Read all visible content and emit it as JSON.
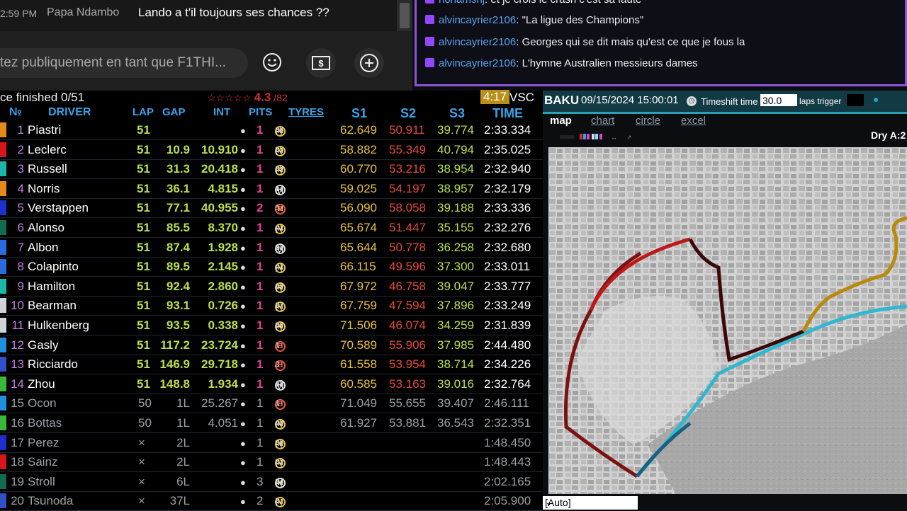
{
  "youtube_chat": {
    "message": {
      "time": "2:59 PM",
      "author": "Papa Ndambo",
      "text": "Lando a t'il toujours ses chances ??"
    },
    "input_placeholder": "tez publiquement en tant que F1THI..."
  },
  "twitch_chat": {
    "messages": [
      {
        "user": "nonamshj",
        "text": "et je crois le crash c'est sa faute"
      },
      {
        "user": "alvincayrier2106",
        "text": "\"La ligue des Champions\""
      },
      {
        "user": "alvincayrier2106",
        "text": "Georges qui se dit mais qu'est ce que je fous la"
      },
      {
        "user": "alvincayrier2106",
        "text": "L'hymne Australien messieurs dames"
      }
    ]
  },
  "timing": {
    "status": "ce finished  0/51",
    "rating_stars": "☆☆☆☆☆",
    "rating_value": "4.3",
    "rating_count": "/82",
    "session_time": "4:17",
    "session_flag": "VSC",
    "headers": {
      "pos": "№",
      "driver": "DRIVER",
      "lap": "LAP",
      "gap": "GAP",
      "int": "INT",
      "pits": "PITS",
      "tyres": "TYRES",
      "s1": "S1",
      "s2": "S2",
      "s3": "S3",
      "time": "TIME"
    },
    "rows": [
      {
        "pos": "1",
        "name": "Piastri",
        "team_color": "#e88a1a",
        "lap": "51",
        "gap": "",
        "int": "",
        "dot": "●",
        "pits": "1",
        "tyres": [
          {
            "c": "M"
          },
          {
            "c": "H",
            "letter": true,
            "age": "36"
          }
        ],
        "s1": "62.649",
        "s2": "50.911",
        "s3": "39.774",
        "time": "2:33.334",
        "dim": false
      },
      {
        "pos": "2",
        "name": "Leclerc",
        "team_color": "#d8151a",
        "lap": "51",
        "gap": "10.9",
        "int": "10.910",
        "dot": "●",
        "pits": "1",
        "tyres": [
          {
            "c": "M"
          },
          {
            "c": "H",
            "letter": true,
            "age": "35"
          }
        ],
        "s1": "58.882",
        "s2": "55.349",
        "s3": "40.794",
        "time": "2:35.025",
        "dim": false
      },
      {
        "pos": "3",
        "name": "Russell",
        "team_color": "#1ab8a8",
        "lap": "51",
        "gap": "31.3",
        "int": "20.418",
        "dot": "●",
        "pits": "1",
        "tyres": [
          {
            "c": "M"
          },
          {
            "c": "H",
            "letter": true,
            "age": "39"
          }
        ],
        "s1": "60.770",
        "s2": "53.216",
        "s3": "38.954",
        "time": "2:32.940",
        "dim": false
      },
      {
        "pos": "4",
        "name": "Norris",
        "team_color": "#e88a1a",
        "lap": "51",
        "gap": "36.1",
        "int": "4.815",
        "dot": "●",
        "pits": "1",
        "tyres": [
          {
            "c": "H"
          },
          {
            "c": "M",
            "letter": true,
            "age": "14"
          }
        ],
        "s1": "59.025",
        "s2": "54.197",
        "s3": "38.957",
        "time": "2:32.179",
        "dim": false
      },
      {
        "pos": "5",
        "name": "Verstappen",
        "team_color": "#1e2fcf",
        "lap": "51",
        "gap": "77.1",
        "int": "40.955",
        "dot": "●",
        "pits": "2",
        "tyres": [
          {
            "c": "M"
          },
          {
            "c": "H"
          },
          {
            "c": "S",
            "age": "5"
          }
        ],
        "s1": "56.090",
        "s2": "58.058",
        "s3": "39.188",
        "time": "2:33.336",
        "dim": false
      },
      {
        "pos": "6",
        "name": "Alonso",
        "team_color": "#0f6b52",
        "lap": "51",
        "gap": "85.5",
        "int": "8.370",
        "dot": "●",
        "pits": "1",
        "tyres": [
          {
            "c": "M"
          },
          {
            "c": "H",
            "letter": true,
            "age": "41"
          }
        ],
        "s1": "65.674",
        "s2": "51.447",
        "s3": "35.155",
        "time": "2:32.276",
        "dim": false
      },
      {
        "pos": "7",
        "name": "Albon",
        "team_color": "#2a6be0",
        "lap": "51",
        "gap": "87.4",
        "int": "1.928",
        "dot": "●",
        "pits": "1",
        "tyres": [
          {
            "c": "H"
          },
          {
            "c": "M",
            "letter": true,
            "age": "20"
          }
        ],
        "s1": "65.644",
        "s2": "50.778",
        "s3": "36.258",
        "time": "2:32.680",
        "dim": false
      },
      {
        "pos": "8",
        "name": "Colapinto",
        "team_color": "#2a6be0",
        "lap": "51",
        "gap": "89.5",
        "int": "2.145",
        "dot": "●",
        "pits": "1",
        "tyres": [
          {
            "c": "M"
          },
          {
            "c": "H",
            "letter": true,
            "age": "41"
          }
        ],
        "s1": "66.115",
        "s2": "49.596",
        "s3": "37.300",
        "time": "2:33.011",
        "dim": false
      },
      {
        "pos": "9",
        "name": "Hamilton",
        "team_color": "#1ab8a8",
        "lap": "51",
        "gap": "92.4",
        "int": "2.860",
        "dot": "●",
        "pits": "1",
        "tyres": [
          {
            "c": "M"
          },
          {
            "c": "H",
            "letter": true,
            "age": "39"
          }
        ],
        "s1": "67.972",
        "s2": "46.758",
        "s3": "39.047",
        "time": "2:33.777",
        "dim": false
      },
      {
        "pos": "10",
        "name": "Bearman",
        "team_color": "#cfd2d6",
        "lap": "51",
        "gap": "93.1",
        "int": "0.726",
        "dot": "●",
        "pits": "1",
        "tyres": [
          {
            "c": "M"
          },
          {
            "c": "H",
            "letter": true,
            "age": "37"
          }
        ],
        "s1": "67.759",
        "s2": "47.594",
        "s3": "37.896",
        "time": "2:33.249",
        "dim": false
      },
      {
        "pos": "11",
        "name": "Hulkenberg",
        "team_color": "#cfd2d6",
        "lap": "51",
        "gap": "93.5",
        "int": "0.338",
        "dot": "●",
        "pits": "1",
        "tyres": [
          {
            "c": "M"
          },
          {
            "c": "H",
            "letter": true,
            "age": "36"
          }
        ],
        "s1": "71.506",
        "s2": "46.074",
        "s3": "34.259",
        "time": "2:31.839",
        "dim": false
      },
      {
        "pos": "12",
        "name": "Gasly",
        "team_color": "#1e90e0",
        "lap": "51",
        "gap": "117.2",
        "int": "23.724",
        "dot": "●",
        "pits": "1",
        "tyres": [
          {
            "c": "H"
          },
          {
            "c": "S",
            "age": "1"
          }
        ],
        "s1": "70.589",
        "s2": "55.906",
        "s3": "37.985",
        "time": "2:44.480",
        "dim": false
      },
      {
        "pos": "13",
        "name": "Ricciardo",
        "team_color": "#3150c8",
        "lap": "51",
        "gap": "146.9",
        "int": "29.718",
        "dot": "●",
        "pits": "1",
        "tyres": [
          {
            "c": "H"
          },
          {
            "c": "S",
            "age": "2"
          }
        ],
        "s1": "61.558",
        "s2": "53.954",
        "s3": "38.714",
        "time": "2:34.226",
        "dim": false
      },
      {
        "pos": "14",
        "name": "Zhou",
        "team_color": "#3ab83a",
        "lap": "51",
        "gap": "148.8",
        "int": "1.934",
        "dot": "●",
        "pits": "1",
        "tyres": [
          {
            "c": "H"
          },
          {
            "c": "M",
            "letter": true,
            "age": "18"
          }
        ],
        "s1": "60.585",
        "s2": "53.163",
        "s3": "39.016",
        "time": "2:32.764",
        "dim": false
      },
      {
        "pos": "15",
        "name": "Ocon",
        "team_color": "#1e90e0",
        "lap": "50",
        "gap": "1L",
        "int": "25.267",
        "dot": "●",
        "pits": "1",
        "tyres": [
          {
            "c": "H"
          },
          {
            "c": "S",
            "age": "1"
          }
        ],
        "s1": "71.049",
        "s2": "55.655",
        "s3": "39.407",
        "time": "2:46.111",
        "dim": true
      },
      {
        "pos": "16",
        "name": "Bottas",
        "team_color": "#3ab83a",
        "lap": "50",
        "gap": "1L",
        "int": "4.051",
        "dot": "●",
        "pits": "1",
        "tyres": [
          {
            "c": "M"
          },
          {
            "c": "H",
            "letter": true,
            "age": "40"
          }
        ],
        "s1": "61.927",
        "s2": "53.881",
        "s3": "36.543",
        "time": "2:32.351",
        "dim": true
      },
      {
        "pos": "17",
        "name": "Perez",
        "team_color": "#1e2fcf",
        "lap": "×",
        "gap": "2L",
        "int": "",
        "dot": "●",
        "pits": "1",
        "tyres": [
          {
            "c": "M"
          },
          {
            "c": "H",
            "letter": true,
            "age": "36"
          }
        ],
        "s1": "",
        "s2": "",
        "s3": "",
        "time": "1:48.450",
        "dim": true
      },
      {
        "pos": "18",
        "name": "Sainz",
        "team_color": "#d8151a",
        "lap": "×",
        "gap": "2L",
        "int": "",
        "dot": "●",
        "pits": "1",
        "tyres": [
          {
            "c": "M"
          },
          {
            "c": "H",
            "letter": true,
            "age": "32"
          }
        ],
        "s1": "",
        "s2": "",
        "s3": "",
        "time": "1:48.443",
        "dim": true
      },
      {
        "pos": "19",
        "name": "Stroll",
        "team_color": "#0f6b52",
        "lap": "×",
        "gap": "6L",
        "int": "",
        "dot": "●",
        "pits": "3",
        "tyres": [
          {
            "c": "M"
          },
          {
            "c": "H"
          },
          {
            "c": "H",
            "letter": true,
            "age": "24"
          }
        ],
        "s1": "",
        "s2": "",
        "s3": "",
        "time": "2:02.165",
        "dim": true
      },
      {
        "pos": "20",
        "name": "Tsunoda",
        "team_color": "#3150c8",
        "lap": "×",
        "gap": "37L",
        "int": "",
        "dot": "●",
        "pits": "2",
        "tyres": [
          {
            "c": "M"
          },
          {
            "c": "H",
            "letter": true,
            "age": "3"
          }
        ],
        "s1": "",
        "s2": "",
        "s3": "",
        "time": "2:05.900",
        "dim": true
      }
    ]
  },
  "map": {
    "circuit": "BAKU",
    "datetime": "09/15/2024 15:00:01",
    "timeshift_label": "Timeshift time",
    "timeshift_value": "30.0",
    "laps_trigger_label": "laps trigger",
    "tabs": [
      "map",
      "chart",
      "circle",
      "excel"
    ],
    "weather": "Dry A:2",
    "view_select": "[Auto]"
  },
  "colors": {
    "accent_blue": "#3aa3e8",
    "lap_green": "#b9e04e",
    "s1_yellow": "#e9c23c",
    "s2_red": "#e34b3b",
    "vsc_gold": "#b8901a",
    "twitch_purple": "#8b56d9"
  }
}
